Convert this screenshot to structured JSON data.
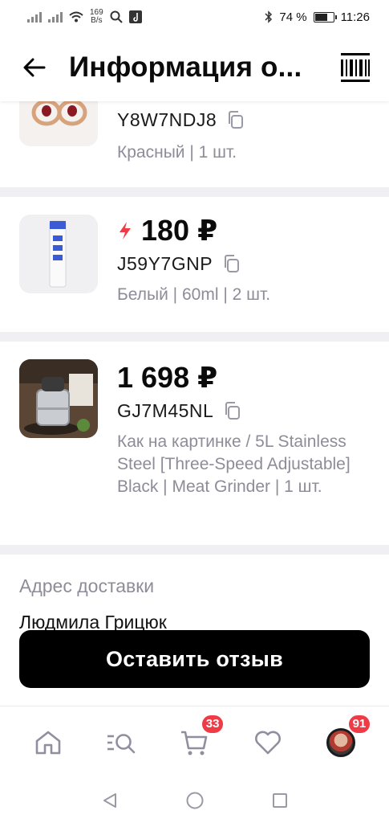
{
  "status_bar": {
    "net_speed_value": "169",
    "net_speed_unit": "B/s",
    "battery_percent": "74 %",
    "battery_level": 0.74,
    "time": "11:26"
  },
  "header": {
    "title": "Информация о...",
    "back_icon": "arrow-left-icon",
    "barcode_icon": "barcode-icon"
  },
  "items": [
    {
      "sku": "Y8W7NDJ8",
      "description": "Красный | 1 шт.",
      "image": "rings-product-image"
    },
    {
      "price": "180 ₽",
      "sku": "J59Y7GNP",
      "description": "Белый | 60ml | 2 шт.",
      "lightning_color": "#ee3b45",
      "image": "tube-product-image"
    },
    {
      "price": "1 698 ₽",
      "sku": "GJ7M45NL",
      "description": "Как на картинке / 5L Stainless Steel [Three-Speed Adjustable] Black | Meat Grinder | 1 шт.",
      "image": "meat-grinder-product-image"
    }
  ],
  "delivery": {
    "title": "Адрес доставки",
    "recipient": "Людмила Грицюк"
  },
  "review_button": "Оставить отзыв",
  "bottom_nav": {
    "cart_badge": "33",
    "profile_badge": "91",
    "icons": [
      "home-icon",
      "search-icon",
      "cart-icon",
      "heart-icon",
      "profile-avatar"
    ]
  },
  "colors": {
    "accent": "#000000",
    "badge": "#ef3b45",
    "muted_text": "#8d8d99",
    "separator": "#efeff4"
  }
}
